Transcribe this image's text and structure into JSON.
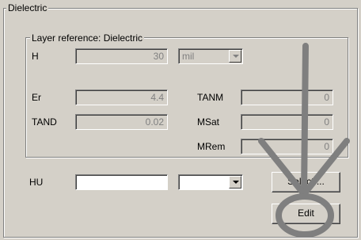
{
  "dielectric_group": {
    "title": "Dielectric"
  },
  "layer_group": {
    "title": "Layer reference: Dielectric"
  },
  "fields": {
    "h": {
      "label": "H",
      "value": "30",
      "unit": "mil"
    },
    "er": {
      "label": "Er",
      "value": "4.4"
    },
    "tand": {
      "label": "TAND",
      "value": "0.02"
    },
    "tanm": {
      "label": "TANM",
      "value": "0"
    },
    "msat": {
      "label": "MSat",
      "value": "0"
    },
    "mrem": {
      "label": "MRem",
      "value": "0"
    }
  },
  "hu": {
    "label": "HU",
    "value": "",
    "combo_value": ""
  },
  "buttons": {
    "select_label": "Select ...",
    "edit_label": "Edit"
  },
  "annotation": {
    "color": "#7f7f7f",
    "shape": "arrow-down-to-circle"
  }
}
